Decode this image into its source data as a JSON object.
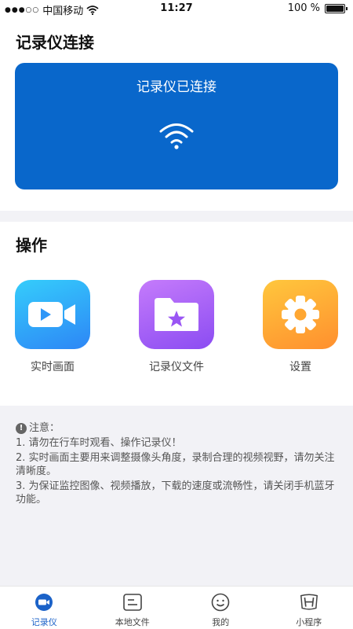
{
  "status_bar": {
    "signal_dots": "●●●○○",
    "carrier": "中国移动",
    "time": "11:27",
    "battery_text": "100 %",
    "battery_level": 1.0
  },
  "connect_section": {
    "title": "记录仪连接",
    "status": "记录仪已连接",
    "card_color": "#0967cb"
  },
  "operations": {
    "title": "操作",
    "items": [
      {
        "label": "实时画面",
        "icon": "video-camera-icon"
      },
      {
        "label": "记录仪文件",
        "icon": "folder-star-icon"
      },
      {
        "label": "设置",
        "icon": "gear-icon"
      }
    ]
  },
  "notes": {
    "heading": "注意：",
    "lines": [
      "1. 请勿在行车时观看、操作记录仪！",
      "2. 实时画面主要用来调整摄像头角度，录制合理的视频视野，请勿关注清晰度。",
      "3. 为保证监控图像、视频播放，下载的速度或流畅性，请关闭手机蓝牙功能。"
    ]
  },
  "tabbar": {
    "active_color": "#1b62c8",
    "items": [
      {
        "label": "记录仪",
        "icon": "recorder-icon",
        "active": true
      },
      {
        "label": "本地文件",
        "icon": "local-files-icon",
        "active": false
      },
      {
        "label": "我的",
        "icon": "smiley-icon",
        "active": false
      },
      {
        "label": "小程序",
        "icon": "honda-logo-icon",
        "active": false
      }
    ]
  }
}
